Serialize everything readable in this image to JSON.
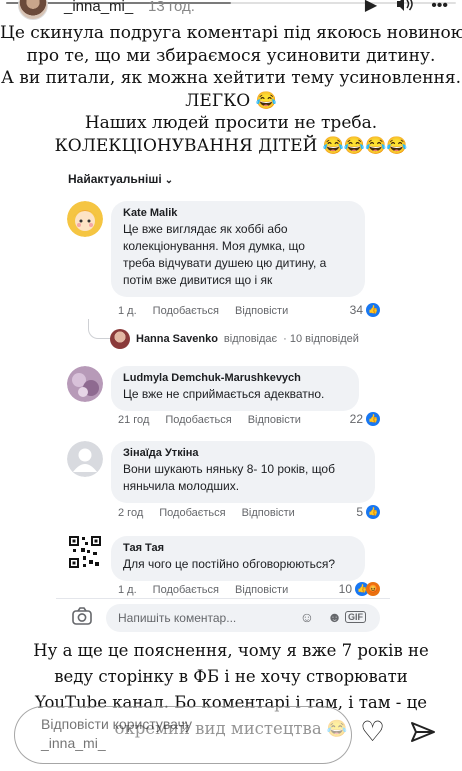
{
  "story": {
    "username": "_inna_mi_",
    "time": "13 год.",
    "progress_fraction": 0.5
  },
  "top_caption": {
    "lines": [
      "Це скинула подруга коментарі під якоюсь новиною",
      "про те, що ми збираємося усиновити дитину.",
      "А ви питали, як можна хейтити тему усиновлення.",
      "ЛЕГКО 😂",
      "Наших людей просити не треба.",
      "КОЛЕКЦІОНУВАННЯ ДІТЕЙ 😂😂😂😂"
    ]
  },
  "fb": {
    "sort_label": "Найактуальніші",
    "comments": [
      {
        "name": "Kate Malik",
        "text_lines": [
          "Це вже виглядає як хоббі або",
          "колекціонування. Моя думка, що",
          "треба відчувати душею цю дитину, а",
          "потім вже дивитися що і як"
        ],
        "age": "1 д.",
        "like": "Подобається",
        "reply": "Відповісти",
        "count": "34",
        "reply_summary": {
          "name": "Hanna Savenko",
          "action": "відповідає",
          "count": "· 10 відповідей"
        }
      },
      {
        "name": "Ludmyla Demchuk-Marushkevych",
        "text_lines": [
          "Це вже не сприймається адекватно."
        ],
        "age": "21 год",
        "like": "Подобається",
        "reply": "Відповісти",
        "count": "22"
      },
      {
        "name": "Зінаїда Уткіна",
        "text_lines": [
          "Вони шукають няньку 8- 10 років, щоб",
          "няньчила молодших."
        ],
        "age": "2 год",
        "like": "Подобається",
        "reply": "Відповісти",
        "count": "5"
      },
      {
        "name": "Тая Тая",
        "text_lines": [
          "Для чого це постійно обговорюються?"
        ],
        "age": "1 д.",
        "like": "Подобається",
        "reply": "Відповісти",
        "count": "10"
      }
    ],
    "composer_placeholder": "Напишіть коментар...",
    "composer_gif": "GIF"
  },
  "bottom_caption": {
    "lines": [
      "Ну а ще це пояснення, чому я вже 7 років не",
      "веду сторінку в ФБ і не хочу створювати",
      "YouTube канал. Бо коментарі і там, і там - це",
      "окремий вид мистецтва 😂"
    ]
  },
  "reply_bar": {
    "placeholder_line1": "Відповісти користувачу",
    "placeholder_line2": "_inna_mi_"
  },
  "icons": {
    "play": "play-icon",
    "volume": "volume-icon",
    "more": "more-icon",
    "camera": "camera-icon",
    "heart": "heart-icon",
    "send": "send-icon"
  },
  "colors": {
    "facebook_blue": "#1877f2",
    "bubble_gray": "#f0f2f5"
  }
}
